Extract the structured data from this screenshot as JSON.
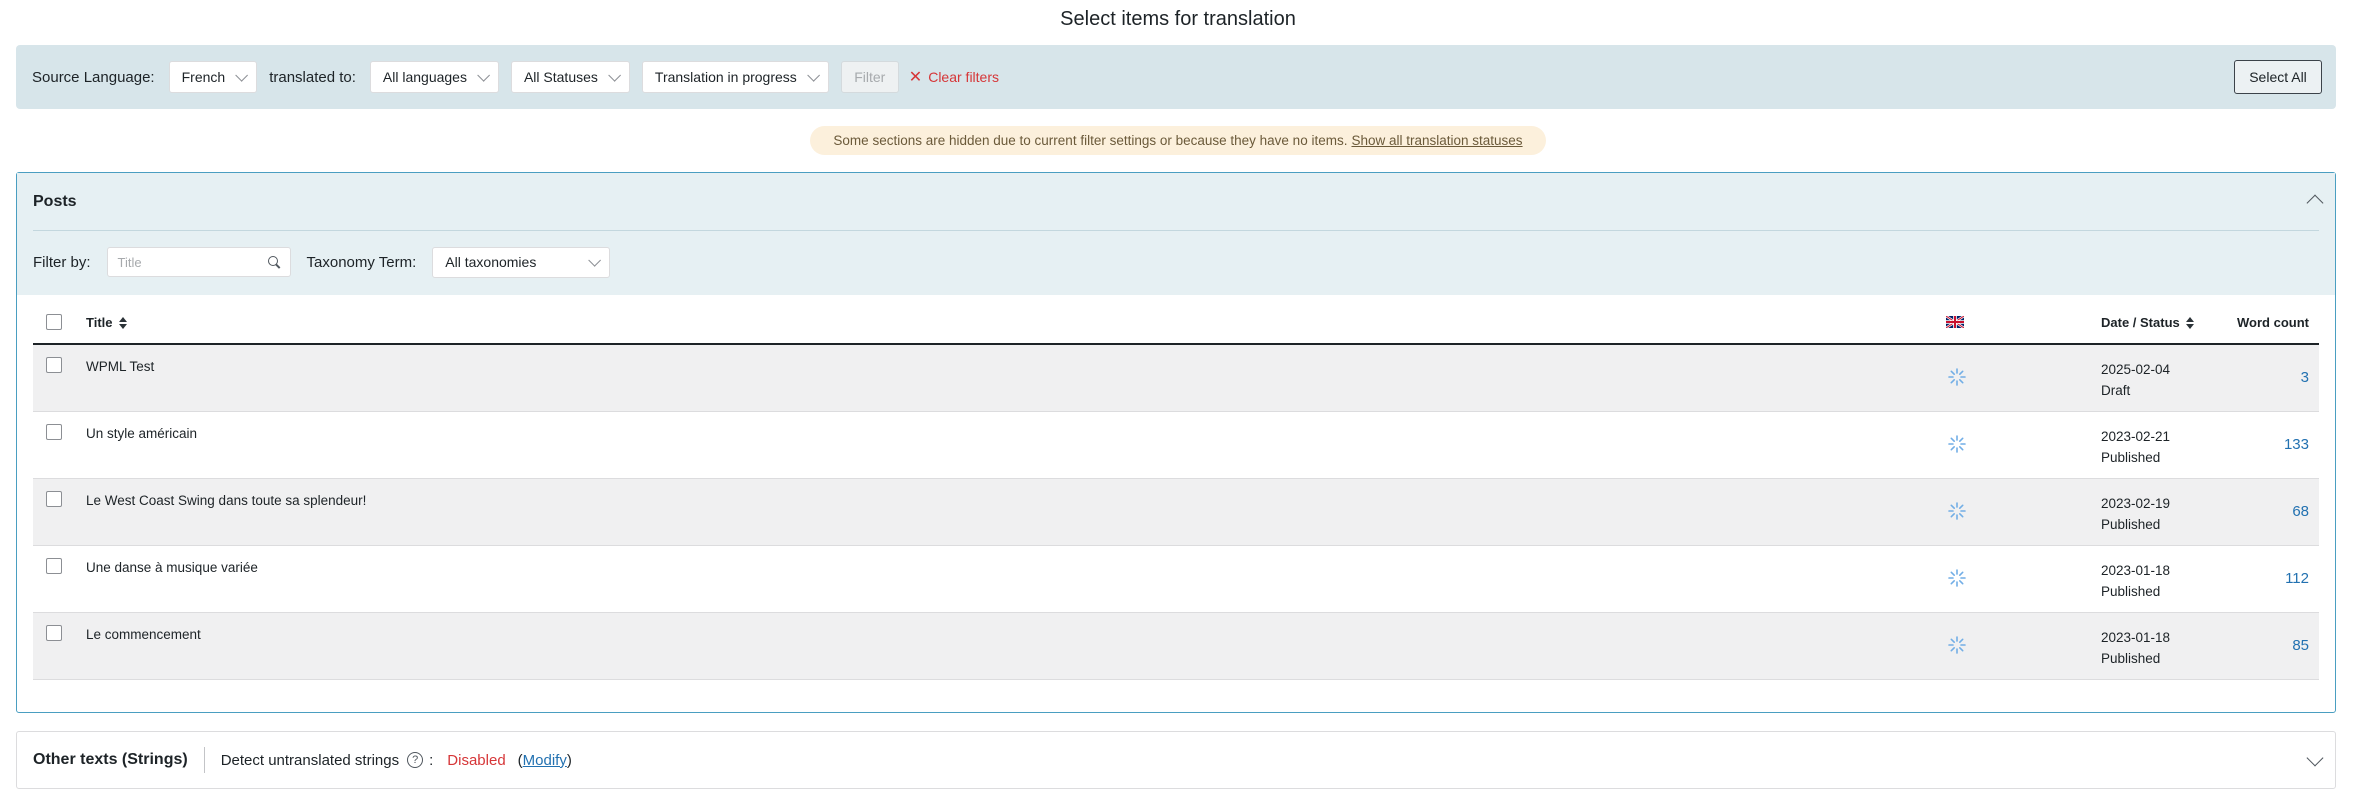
{
  "page_title": "Select items for translation",
  "filter_bar": {
    "source_language_label": "Source Language:",
    "source_language_value": "French",
    "translated_to_label": "translated to:",
    "target_language_value": "All languages",
    "status_value": "All Statuses",
    "translation_status_value": "Translation in progress",
    "filter_button": "Filter",
    "clear_filters": "Clear filters",
    "select_all": "Select All"
  },
  "notice": {
    "text": "Some sections are hidden due to current filter settings or because they have no items.",
    "link": "Show all translation statuses"
  },
  "posts": {
    "title": "Posts",
    "filter_by_label": "Filter by:",
    "search_placeholder": "Title",
    "taxonomy_label": "Taxonomy Term:",
    "taxonomy_value": "All taxonomies",
    "columns": {
      "title": "Title",
      "date_status": "Date / Status",
      "word_count": "Word count"
    },
    "rows": [
      {
        "title": "WPML Test",
        "date": "2025-02-04",
        "status": "Draft",
        "word_count": "3"
      },
      {
        "title": "Un style américain",
        "date": "2023-02-21",
        "status": "Published",
        "word_count": "133"
      },
      {
        "title": "Le West Coast Swing dans toute sa splendeur!",
        "date": "2023-02-19",
        "status": "Published",
        "word_count": "68"
      },
      {
        "title": "Une danse à musique variée",
        "date": "2023-01-18",
        "status": "Published",
        "word_count": "112"
      },
      {
        "title": "Le commencement",
        "date": "2023-01-18",
        "status": "Published",
        "word_count": "85"
      }
    ]
  },
  "strings": {
    "title": "Other texts (Strings)",
    "detect_label": "Detect untranslated strings",
    "colon": ":",
    "status": "Disabled",
    "modify_open": "(",
    "modify_link": "Modify",
    "modify_close": ")"
  },
  "colors": {
    "filter_bar_bg": "#d7e5ea",
    "accent_link": "#2271b1",
    "danger": "#d63638",
    "panel_border": "#4a9ec1"
  }
}
